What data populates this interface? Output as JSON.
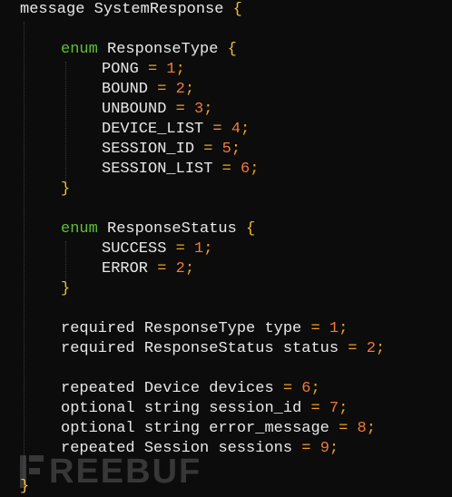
{
  "code": {
    "message_open": "message",
    "message_name": "SystemResponse",
    "enum1": {
      "keyword": "enum",
      "name": "ResponseType",
      "values": [
        {
          "name": "PONG",
          "num": "1"
        },
        {
          "name": "BOUND",
          "num": "2"
        },
        {
          "name": "UNBOUND",
          "num": "3"
        },
        {
          "name": "DEVICE_LIST",
          "num": "4"
        },
        {
          "name": "SESSION_ID",
          "num": "5"
        },
        {
          "name": "SESSION_LIST",
          "num": "6"
        }
      ]
    },
    "enum2": {
      "keyword": "enum",
      "name": "ResponseStatus",
      "values": [
        {
          "name": "SUCCESS",
          "num": "1"
        },
        {
          "name": "ERROR",
          "num": "2"
        }
      ]
    },
    "fields1": [
      {
        "label": "required",
        "type": "ResponseType",
        "name": "type",
        "num": "1"
      },
      {
        "label": "required",
        "type": "ResponseStatus",
        "name": "status",
        "num": "2"
      }
    ],
    "fields2": [
      {
        "label": "repeated",
        "type": "Device",
        "name": "devices",
        "num": "6"
      },
      {
        "label": "optional",
        "type": "string",
        "name": "session_id",
        "num": "7"
      },
      {
        "label": "optional",
        "type": "string",
        "name": "error_message",
        "num": "8"
      },
      {
        "label": "repeated",
        "type": "Session",
        "name": "sessions",
        "num": "9"
      }
    ]
  },
  "watermark": {
    "text": "REEBUF"
  },
  "colors": {
    "background": "#0c0c0c",
    "enum_keyword": "#5fbf3a",
    "number": "#f07a3a",
    "operator": "#f0a020",
    "brace": "#f0c030"
  }
}
